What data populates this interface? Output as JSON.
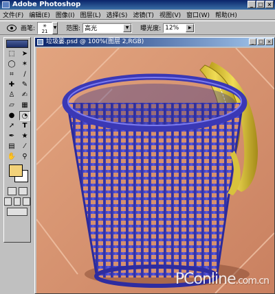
{
  "app": {
    "title": "Adobe Photoshop",
    "window_controls": [
      "_",
      "□",
      "×"
    ]
  },
  "menu": [
    "文件(F)",
    "编辑(E)",
    "图像(I)",
    "图层(L)",
    "选择(S)",
    "滤镜(T)",
    "视图(V)",
    "窗口(W)",
    "帮助(H)"
  ],
  "options_bar": {
    "brush_label": "画笔:",
    "brush_size": "21",
    "range_label": "范围:",
    "range_value": "高光",
    "exposure_label": "曝光度:",
    "exposure_value": "12%"
  },
  "tools": {
    "icons": [
      "marquee-icon",
      "move-icon",
      "lasso-icon",
      "magic-wand-icon",
      "crop-icon",
      "slice-icon",
      "healing-brush-icon",
      "brush-icon",
      "clone-stamp-icon",
      "history-brush-icon",
      "eraser-icon",
      "gradient-icon",
      "blur-icon",
      "dodge-icon",
      "path-selection-icon",
      "type-icon",
      "pen-icon",
      "shape-icon",
      "notes-icon",
      "eyedropper-icon",
      "hand-icon",
      "zoom-icon"
    ],
    "foreground_color": "#f2d27a",
    "background_color": "#ffffff"
  },
  "document": {
    "title": "垃圾篓.psd @ 100%(图层 2,RGB)",
    "window_controls": [
      "_",
      "□",
      "×"
    ]
  },
  "watermark": {
    "brand": "PConline",
    "suffix": ".com.cn"
  }
}
